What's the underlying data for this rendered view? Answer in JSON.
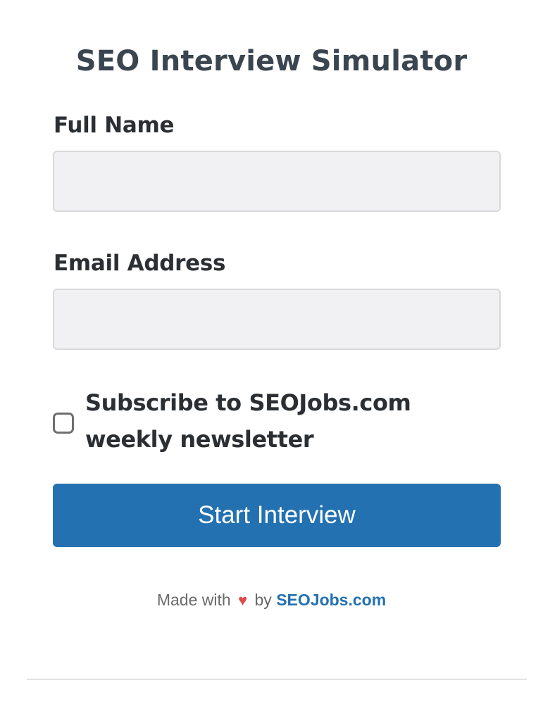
{
  "title": "SEO Interview Simulator",
  "form": {
    "full_name_label": "Full Name",
    "full_name_value": "",
    "full_name_placeholder": "",
    "email_label": "Email Address",
    "email_value": "",
    "email_placeholder": "",
    "subscribe_label": "Subscribe to SEOJobs.com weekly newsletter",
    "subscribe_checked": false,
    "submit_label": "Start Interview"
  },
  "footer": {
    "made_with": "Made with",
    "heart": "♥",
    "by": "by",
    "link_text": "SEOJobs.com"
  },
  "colors": {
    "accent": "#2371b1",
    "heart": "#e04a4a",
    "heading": "#3a4550",
    "input_bg": "#f1f1f3"
  }
}
